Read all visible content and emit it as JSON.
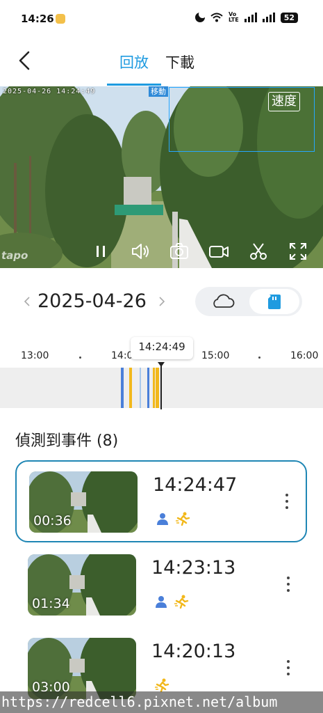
{
  "status_bar": {
    "time": "14:26",
    "volte": "Vo\nLTE",
    "battery": "52"
  },
  "header": {
    "tabs": [
      {
        "label": "回放",
        "active": true
      },
      {
        "label": "下載",
        "active": false
      }
    ]
  },
  "video": {
    "osd_timestamp": "2025-04-26 14:24:49",
    "motion_tag": "移動",
    "speed_label": "速度",
    "watermark": "tapo",
    "controls": [
      "pause-icon",
      "volume-icon",
      "snapshot-icon",
      "record-icon",
      "clip-icon",
      "fullscreen-icon"
    ]
  },
  "date_picker": {
    "date": "2025-04-26",
    "storage": {
      "options": [
        "cloud",
        "sd-card"
      ],
      "selected": "sd-card"
    }
  },
  "timeline": {
    "labels": [
      "13:00",
      "14:0",
      "15:00",
      "16:00"
    ],
    "cursor_time": "14:24:49",
    "colors": {
      "person": "#4a7fd9",
      "motion": "#f2b81b",
      "light": "#a9c8ec"
    }
  },
  "events": {
    "title": "偵測到事件 (8)",
    "items": [
      {
        "time": "14:24:47",
        "duration": "00:36",
        "person": true,
        "motion": true,
        "selected": true
      },
      {
        "time": "14:23:13",
        "duration": "01:34",
        "person": true,
        "motion": true,
        "selected": false
      },
      {
        "time": "14:20:13",
        "duration": "03:00",
        "person": false,
        "motion": true,
        "selected": false
      }
    ]
  },
  "watermark_url": "https://redcell6.pixnet.net/album"
}
